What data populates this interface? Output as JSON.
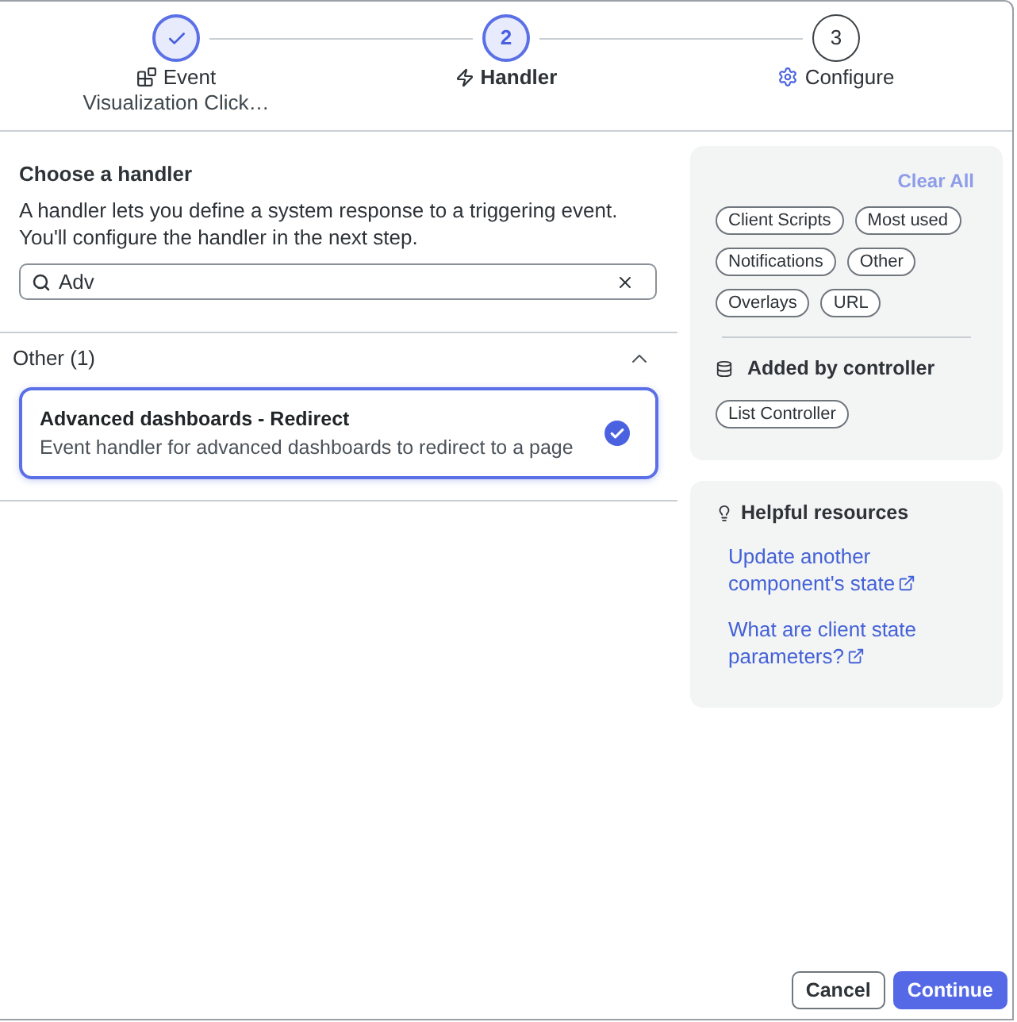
{
  "steps": [
    {
      "label": "Event",
      "sublabel": "Visualization Click…",
      "completed": true,
      "selected": false
    },
    {
      "number": "2",
      "label": "Handler",
      "completed": false,
      "selected": true
    },
    {
      "number": "3",
      "label": "Configure",
      "completed": false,
      "selected": false
    }
  ],
  "handler": {
    "heading": "Choose a handler",
    "description": "A handler lets you define a system response to a triggering event. You'll configure the handler in the next step.",
    "search": {
      "value": "Adv"
    }
  },
  "groups": [
    {
      "title": "Other (1)",
      "expanded": true,
      "items": [
        {
          "title": "Advanced dashboards - Redirect",
          "description": "Event handler for advanced dashboards to redirect to a page",
          "selected": true
        }
      ]
    }
  ],
  "filters": {
    "clear_all": {
      "label": "Clear All",
      "disabled": true
    },
    "chips": [
      {
        "label": "Client Scripts",
        "selected": false
      },
      {
        "label": "Most used",
        "selected": false
      },
      {
        "label": "Notifications",
        "selected": false
      },
      {
        "label": "Other",
        "selected": false
      },
      {
        "label": "Overlays",
        "selected": false
      },
      {
        "label": "URL",
        "selected": false
      }
    ],
    "controller": {
      "title": "Added by controller",
      "chips": [
        {
          "label": "List Controller",
          "selected": false
        }
      ]
    }
  },
  "resources": {
    "title": "Helpful resources",
    "links": [
      {
        "label": "Update another component's state"
      },
      {
        "label": "What are client state parameters?"
      }
    ]
  },
  "buttons": [
    {
      "label": "Cancel",
      "kind": "secondary"
    },
    {
      "label": "Continue",
      "kind": "primary"
    }
  ]
}
